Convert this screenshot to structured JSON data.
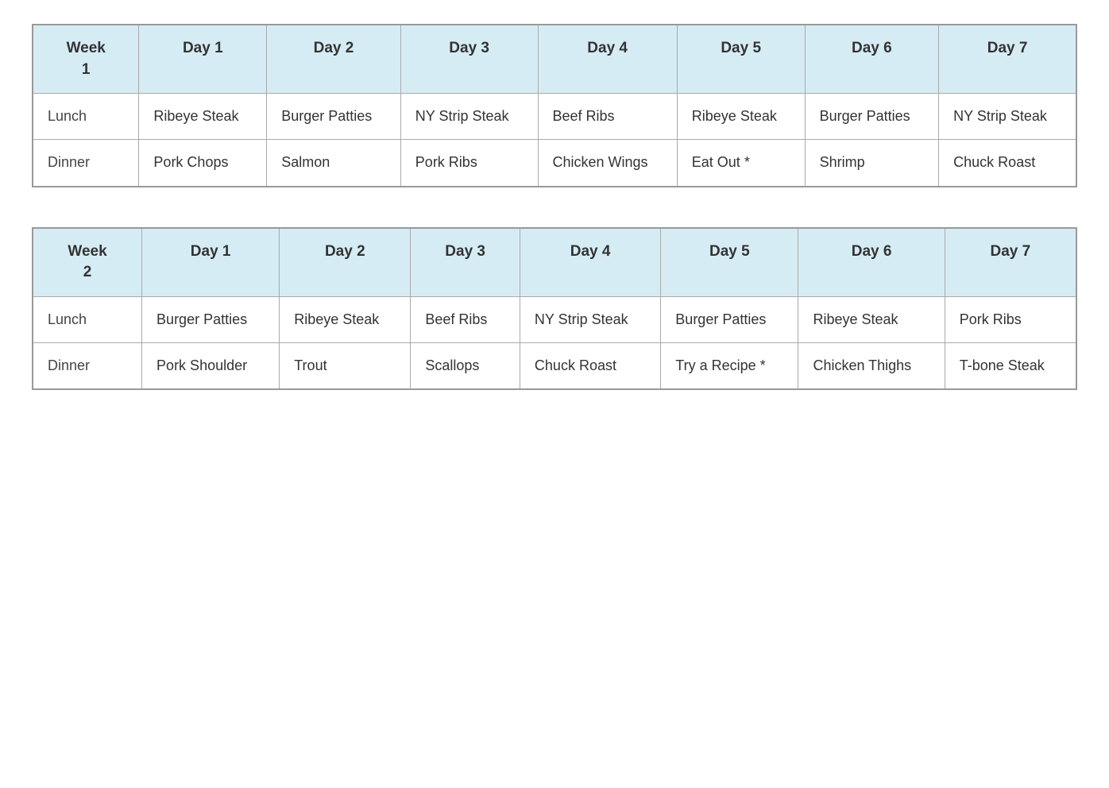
{
  "tables": [
    {
      "id": "week1",
      "header": {
        "week_label": "Week 1",
        "days": [
          "Day 1",
          "Day 2",
          "Day 3",
          "Day 4",
          "Day 5",
          "Day 6",
          "Day 7"
        ]
      },
      "rows": [
        {
          "meal": "Lunch",
          "cells": [
            "Ribeye Steak",
            "Burger Patties",
            "NY Strip Steak",
            "Beef Ribs",
            "Ribeye Steak",
            "Burger Patties",
            "NY Strip Steak"
          ]
        },
        {
          "meal": "Dinner",
          "cells": [
            "Pork Chops",
            "Salmon",
            "Pork Ribs",
            "Chicken Wings",
            "Eat Out *",
            "Shrimp",
            "Chuck Roast"
          ]
        }
      ]
    },
    {
      "id": "week2",
      "header": {
        "week_label": "Week 2",
        "days": [
          "Day 1",
          "Day 2",
          "Day 3",
          "Day 4",
          "Day 5",
          "Day 6",
          "Day 7"
        ]
      },
      "rows": [
        {
          "meal": "Lunch",
          "cells": [
            "Burger Patties",
            "Ribeye Steak",
            "Beef Ribs",
            "NY Strip Steak",
            "Burger Patties",
            "Ribeye Steak",
            "Pork Ribs"
          ]
        },
        {
          "meal": "Dinner",
          "cells": [
            "Pork Shoulder",
            "Trout",
            "Scallops",
            "Chuck Roast",
            "Try a Recipe *",
            "Chicken Thighs",
            "T-bone Steak"
          ]
        }
      ]
    }
  ]
}
